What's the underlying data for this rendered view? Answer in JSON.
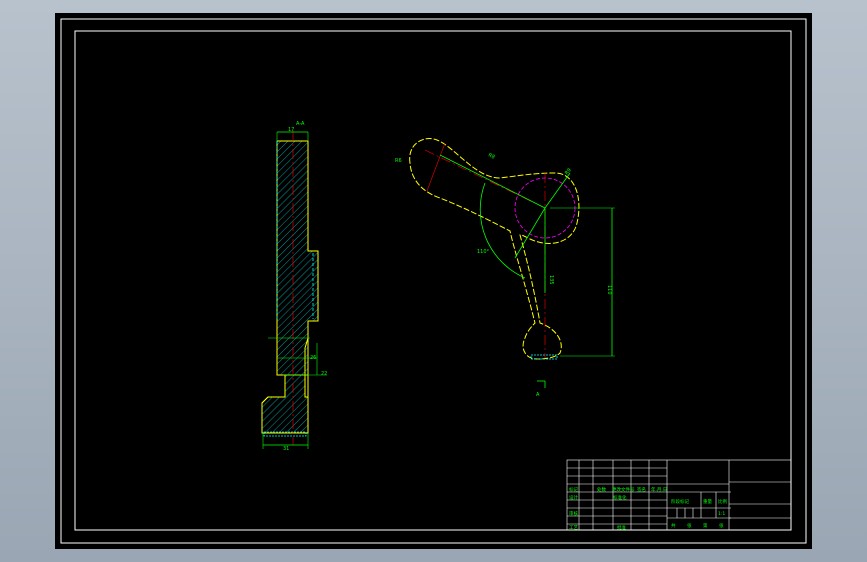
{
  "colors": {
    "background": "#000000",
    "frame": "#ffffff",
    "outline": "#ffff00",
    "dimension": "#00ff00",
    "center_line": "#ff0000",
    "hatch": "#00ffff",
    "accent_circle": "#ff00ff"
  },
  "section_view": {
    "section_label": "A-A",
    "dims": {
      "top_width": "17",
      "step_height": "26",
      "offset": "22",
      "bottom_width": "31"
    }
  },
  "main_view": {
    "dims": {
      "radius_end": "R6",
      "radius_arc": "R8",
      "radius_knob": "R9",
      "angle": "110°",
      "arm_length": "135",
      "height": "110"
    },
    "section_mark": "A"
  },
  "title_block": {
    "row_labels": [
      "标记",
      "处数",
      "更改文件号",
      "签名",
      "年.月.日"
    ],
    "left_labels": [
      "设计",
      "审核",
      "工艺",
      "标准化",
      "批准"
    ],
    "stage_label": "阶段标记",
    "weight_label": "重量",
    "scale_label": "比例",
    "scale_value": "1:1",
    "sheet_labels": [
      "共",
      "张",
      "第",
      "张"
    ]
  }
}
